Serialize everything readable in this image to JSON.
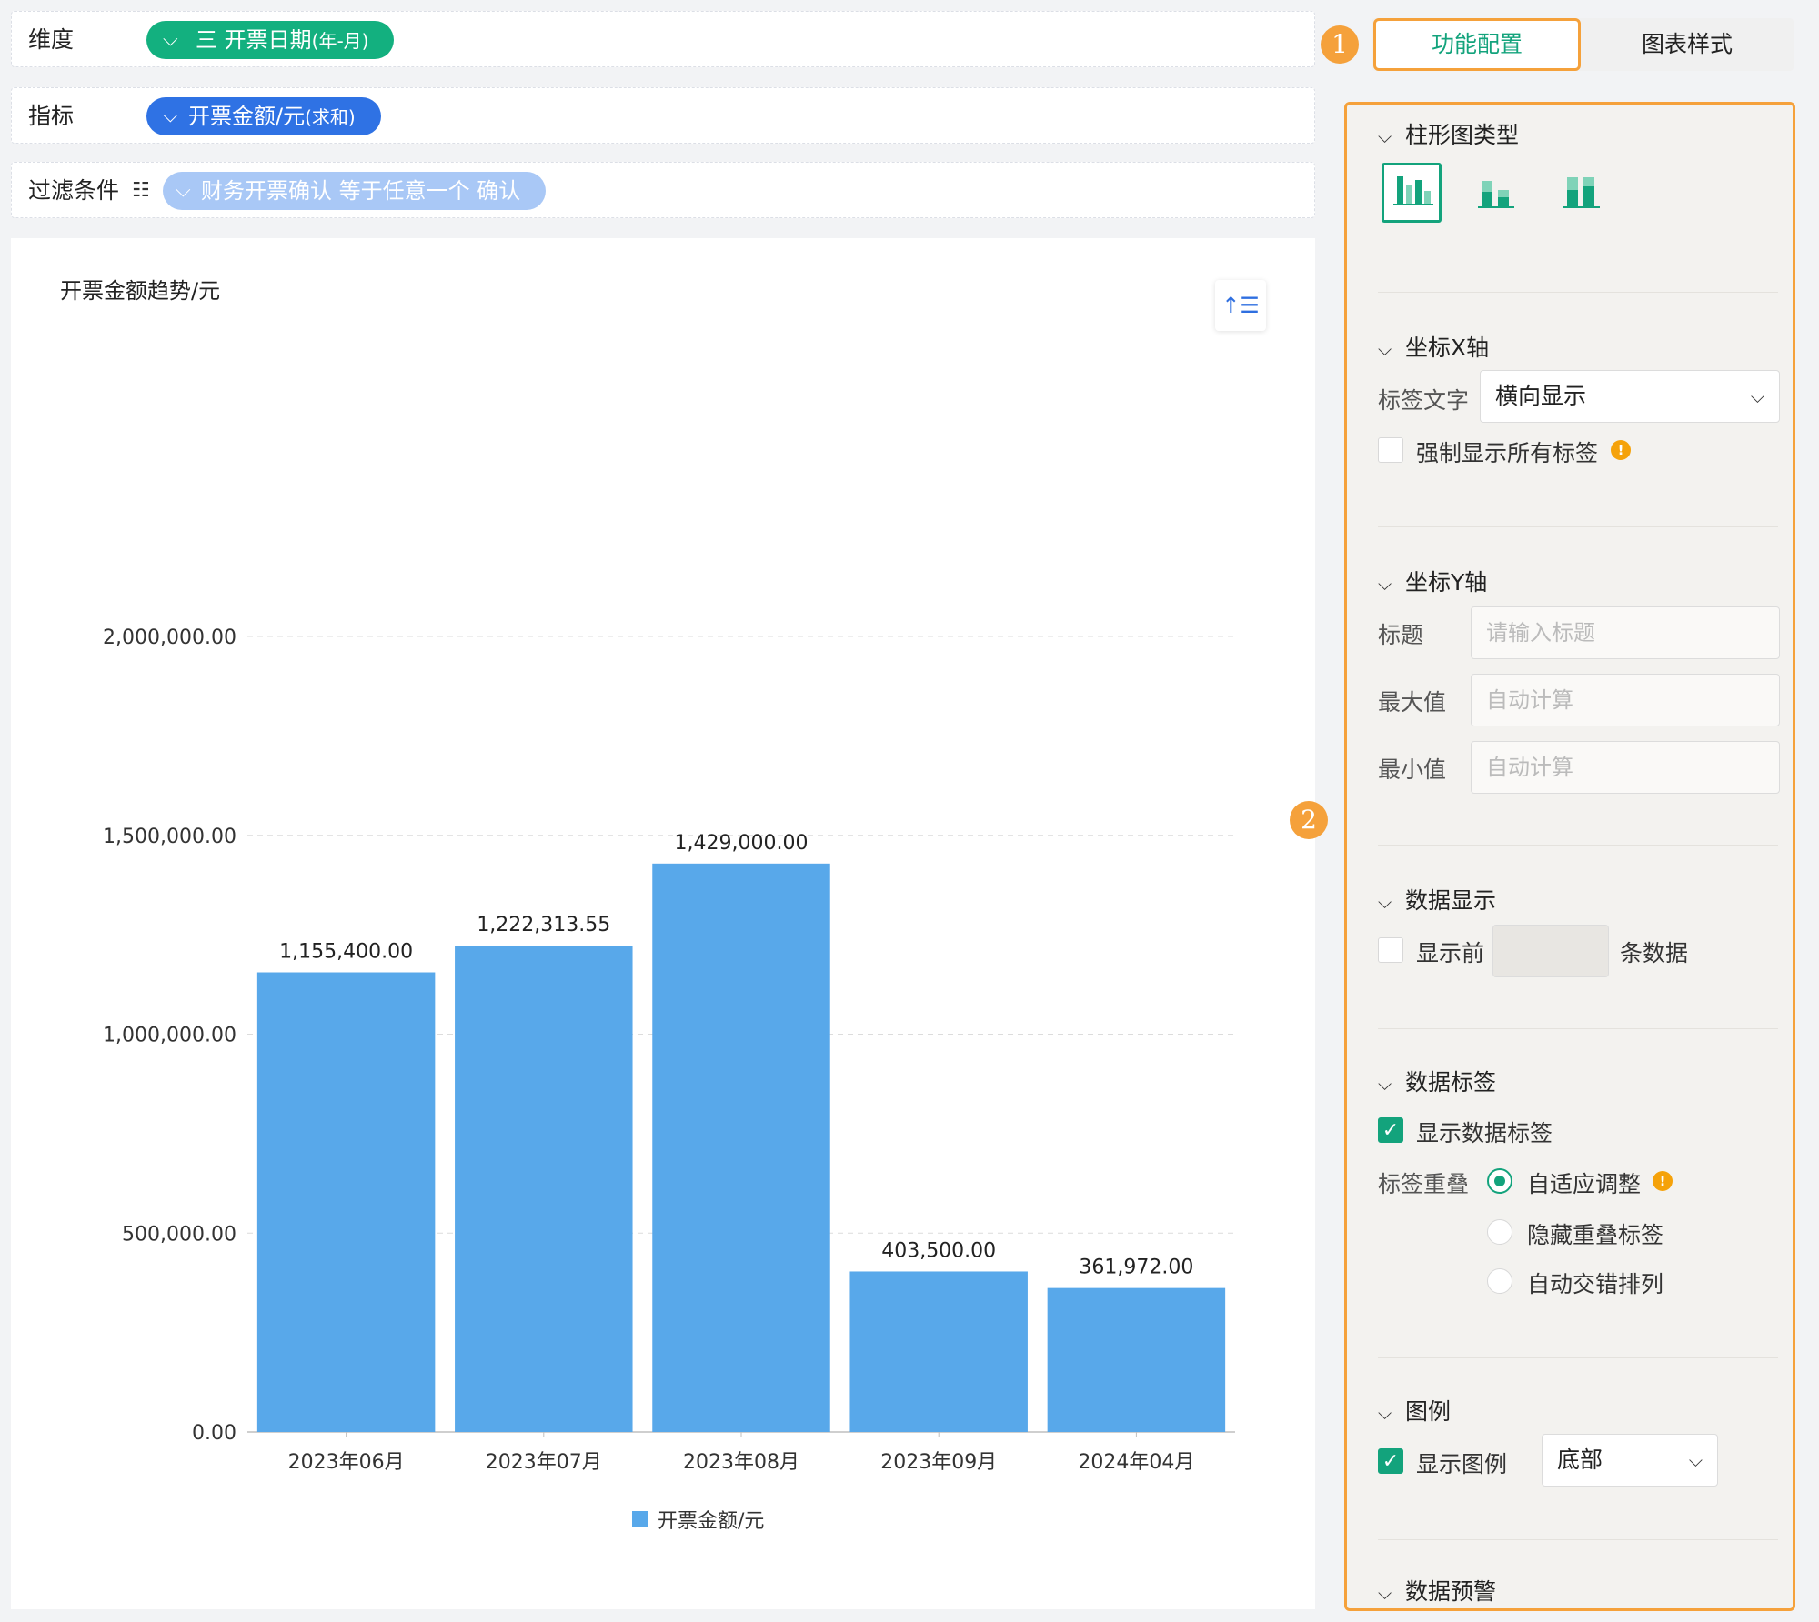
{
  "config": {
    "dimension": {
      "label": "维度",
      "chip_icon": "三",
      "chip_text": "开票日期",
      "chip_suffix": "(年-月)",
      "chip_color": "#13b07f"
    },
    "metric": {
      "label": "指标",
      "chip_text": "开票金额/元",
      "chip_suffix": "(求和)",
      "chip_color": "#2f72e4"
    },
    "filter": {
      "label": "过滤条件",
      "icon": "filter-list-icon",
      "chip_text": "财务开票确认 等于任意一个 确认",
      "chip_color": "#a9c8f6"
    }
  },
  "chart_data": {
    "type": "bar",
    "title": "开票金额趋势/元",
    "categories": [
      "2023年06月",
      "2023年07月",
      "2023年08月",
      "2023年09月",
      "2024年04月"
    ],
    "series": [
      {
        "name": "开票金额/元",
        "values": [
          1155400.0,
          1222313.55,
          1429000.0,
          403500.0,
          361972.0
        ],
        "color": "#58a8ea"
      }
    ],
    "data_labels": [
      "1,155,400.00",
      "1,222,313.55",
      "1,429,000.00",
      "403,500.00",
      "361,972.00"
    ],
    "y_ticks": [
      0,
      500000,
      1000000,
      1500000,
      2000000
    ],
    "y_tick_labels": [
      "0.00",
      "500,000.00",
      "1,000,000.00",
      "1,500,000.00",
      "2,000,000.00"
    ],
    "ylim": [
      0,
      2000000
    ],
    "grid": true,
    "legend_position": "bottom"
  },
  "annotations": {
    "badge1": "1",
    "badge2": "2"
  },
  "tabs": {
    "function_config": "功能配置",
    "chart_style": "图表样式"
  },
  "panel": {
    "bar_type": {
      "title": "柱形图类型"
    },
    "x_axis": {
      "title": "坐标X轴",
      "label_text": "标签文字",
      "label_value": "横向显示",
      "force_all_labels": "强制显示所有标签"
    },
    "y_axis": {
      "title": "坐标Y轴",
      "title_label": "标题",
      "title_placeholder": "请输入标题",
      "max_label": "最大值",
      "max_placeholder": "自动计算",
      "min_label": "最小值",
      "min_placeholder": "自动计算"
    },
    "data_display": {
      "title": "数据显示",
      "show_top": "显示前",
      "rows_suffix": "条数据"
    },
    "data_labels": {
      "title": "数据标签",
      "show": "显示数据标签",
      "overlap_label": "标签重叠",
      "options": [
        "自适应调整",
        "隐藏重叠标签",
        "自动交错排列"
      ]
    },
    "legend": {
      "title": "图例",
      "show": "显示图例",
      "position": "底部"
    },
    "warning": {
      "title": "数据预警"
    }
  },
  "colors": {
    "accent": "#13a37c",
    "annotation": "#f5a13b",
    "warn": "#f5a20a"
  }
}
